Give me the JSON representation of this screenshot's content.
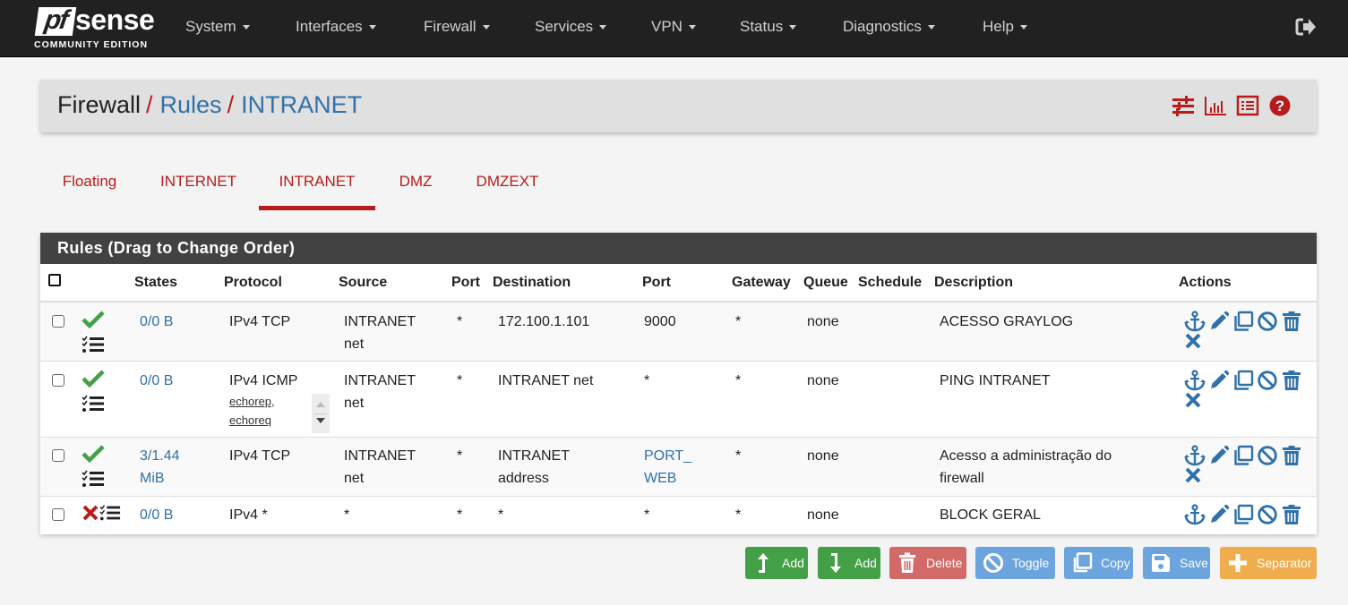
{
  "navbar": {
    "logo": {
      "pf": "pf",
      "sense": "sense",
      "edition": "COMMUNITY EDITION"
    },
    "menus": [
      "System",
      "Interfaces",
      "Firewall",
      "Services",
      "VPN",
      "Status",
      "Diagnostics",
      "Help"
    ],
    "logout_icon": "sign-out-icon"
  },
  "breadcrumb": {
    "items": [
      "Firewall",
      "Rules",
      "INTRANET"
    ],
    "separator": "/",
    "icons": [
      "sliders-icon",
      "bar-chart-icon",
      "list-alt-icon",
      "question-circle-icon"
    ]
  },
  "tabs": [
    {
      "label": "Floating",
      "active": false
    },
    {
      "label": "INTERNET",
      "active": false
    },
    {
      "label": "INTRANET",
      "active": true
    },
    {
      "label": "DMZ",
      "active": false
    },
    {
      "label": "DMZEXT",
      "active": false
    }
  ],
  "rules": {
    "title": "Rules (Drag to Change Order)",
    "columns": [
      "",
      "",
      "States",
      "Protocol",
      "Source",
      "Port",
      "Destination",
      "Port",
      "Gateway",
      "Queue",
      "Schedule",
      "Description",
      "Actions"
    ],
    "rows": [
      {
        "status": "pass",
        "states": "0/0 B",
        "protocol": "IPv4 TCP",
        "protocol_sub": "",
        "source": [
          "INTRANET",
          "net"
        ],
        "source_port": "*",
        "destination": [
          "172.100.1.101"
        ],
        "dest_port": [
          "9000"
        ],
        "dest_port_link": false,
        "gateway": "*",
        "queue": "none",
        "schedule": "",
        "description": [
          "ACESSO GRAYLOG"
        ],
        "actions": [
          "anchor-icon",
          "pencil-icon",
          "copy-icon",
          "ban-icon",
          "trash-icon",
          "times-icon"
        ]
      },
      {
        "status": "pass",
        "states": "0/0 B",
        "protocol": "IPv4 ICMP",
        "protocol_sub": [
          "echorep,",
          "echoreq"
        ],
        "source": [
          "INTRANET",
          "net"
        ],
        "source_port": "*",
        "destination": [
          "INTRANET net"
        ],
        "dest_port": [
          "*"
        ],
        "dest_port_link": false,
        "gateway": "*",
        "queue": "none",
        "schedule": "",
        "description": [
          "PING INTRANET"
        ],
        "actions": [
          "anchor-icon",
          "pencil-icon",
          "copy-icon",
          "ban-icon",
          "trash-icon",
          "times-icon"
        ]
      },
      {
        "status": "pass",
        "states": "3/1.44 MiB",
        "states_lines": [
          "3/1.44",
          "MiB"
        ],
        "protocol": "IPv4 TCP",
        "protocol_sub": "",
        "source": [
          "INTRANET",
          "net"
        ],
        "source_port": "*",
        "destination": [
          "INTRANET",
          "address"
        ],
        "dest_port": [
          "PORT_",
          "WEB"
        ],
        "dest_port_link": true,
        "gateway": "*",
        "queue": "none",
        "schedule": "",
        "description": [
          "Acesso a administração do",
          "firewall"
        ],
        "actions": [
          "anchor-icon",
          "pencil-icon",
          "copy-icon",
          "ban-icon",
          "trash-icon",
          "times-icon"
        ]
      },
      {
        "status": "block",
        "states": "0/0 B",
        "protocol": "IPv4 *",
        "protocol_sub": "",
        "source": [
          "*"
        ],
        "source_port": "*",
        "destination": [
          "*"
        ],
        "dest_port": [
          "*"
        ],
        "dest_port_link": false,
        "gateway": "*",
        "queue": "none",
        "schedule": "",
        "description": [
          "BLOCK GERAL"
        ],
        "actions": [
          "anchor-icon",
          "pencil-icon",
          "copy-icon",
          "ban-icon",
          "trash-icon"
        ]
      }
    ]
  },
  "buttons": [
    {
      "label": "Add",
      "icon": "level-up-icon",
      "color": "#43a047"
    },
    {
      "label": "Add",
      "icon": "level-down-icon",
      "color": "#43a047"
    },
    {
      "label": "Delete",
      "icon": "trash-icon",
      "color": "#d26a68"
    },
    {
      "label": "Toggle",
      "icon": "ban-icon",
      "color": "#6ca4dd"
    },
    {
      "label": "Copy",
      "icon": "copy-icon",
      "color": "#6ca4dd"
    },
    {
      "label": "Save",
      "icon": "save-icon",
      "color": "#6ca4dd"
    },
    {
      "label": "Separator",
      "icon": "plus-icon",
      "color": "#f0ad4e"
    }
  ],
  "colors": {
    "navbar": "#212121",
    "accent_red": "#b71c1c",
    "link_blue": "#3071a9",
    "pass_green": "#43a047",
    "block_red": "#b71c1c"
  }
}
